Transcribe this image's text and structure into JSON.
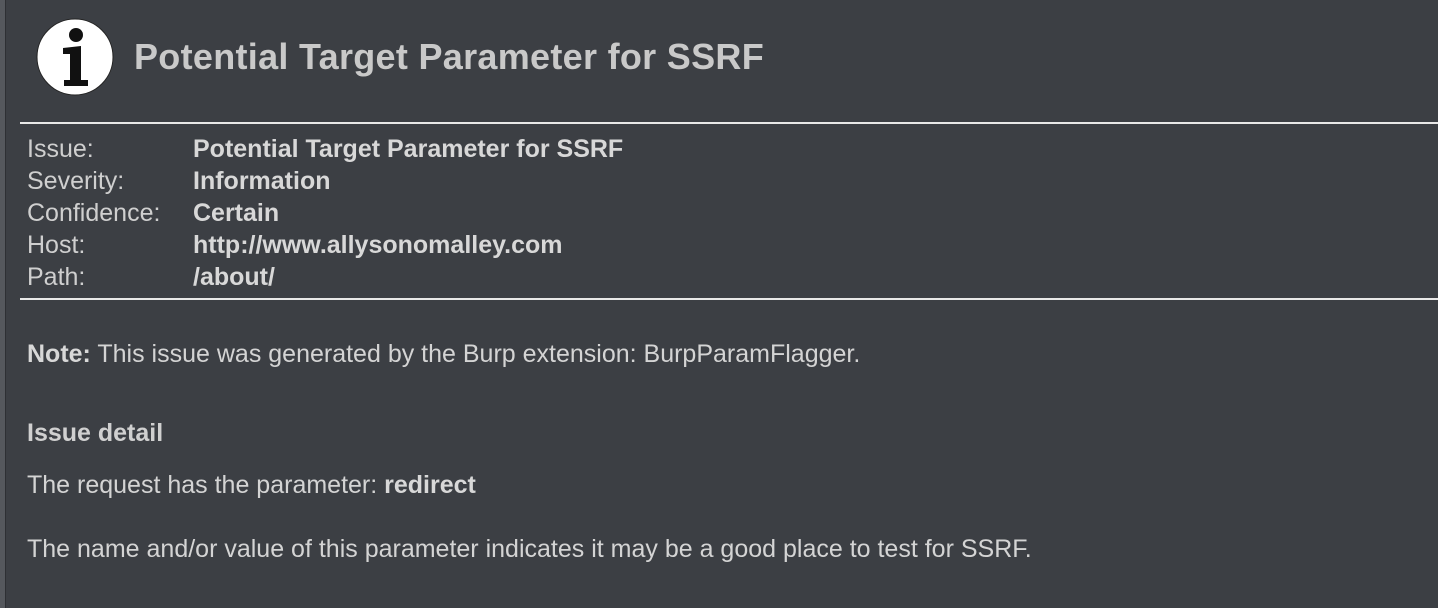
{
  "header": {
    "icon": "info-icon",
    "title": "Potential Target Parameter for SSRF"
  },
  "summary": {
    "rows": [
      {
        "label": "Issue:",
        "value": "Potential Target Parameter for SSRF"
      },
      {
        "label": "Severity:",
        "value": "Information"
      },
      {
        "label": "Confidence:",
        "value": "Certain"
      },
      {
        "label": "Host:",
        "value": "http://www.allysonomalley.com"
      },
      {
        "label": "Path:",
        "value": "/about/"
      }
    ]
  },
  "note": {
    "label": "Note:",
    "text": " This issue was generated by the Burp extension: BurpParamFlagger."
  },
  "detail": {
    "heading": "Issue detail",
    "line1_prefix": "The request has the parameter: ",
    "parameter": "redirect",
    "line2": "The name and/or value of this parameter indicates it may be a good place to test for SSRF."
  }
}
